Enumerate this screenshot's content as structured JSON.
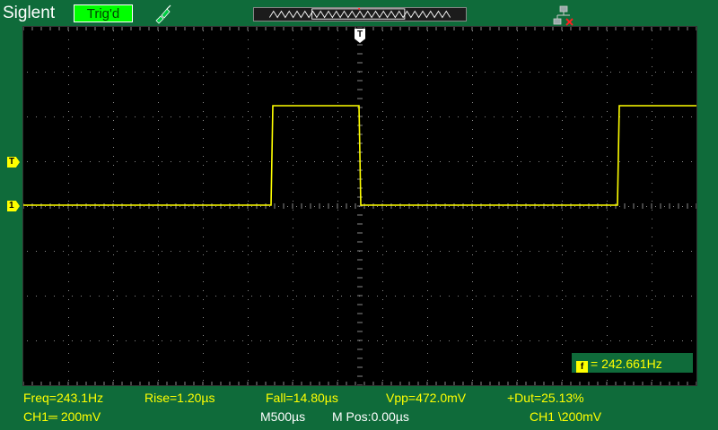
{
  "header": {
    "brand": "Siglent",
    "trigger_status": "Trig'd"
  },
  "screen": {
    "trigger_position_label": "T",
    "trigger_level_label": "T",
    "channel_marker_label": "1",
    "trace_color": "#ffff00",
    "grid_color": "#8a8a8a"
  },
  "frequency_counter": {
    "badge": "f",
    "value": "= 242.661Hz"
  },
  "measurements": {
    "freq": "Freq=243.1Hz",
    "rise": "Rise=1.20µs",
    "fall": "Fall=14.80µs",
    "vpp": "Vpp=472.0mV",
    "duty": "+Dut=25.13%"
  },
  "status_bar": {
    "ch1_scale": "CH1═ 200mV",
    "timebase": "M500µs",
    "main_position": "M Pos:0.00µs",
    "trigger_info": "CH1 \\200mV"
  }
}
